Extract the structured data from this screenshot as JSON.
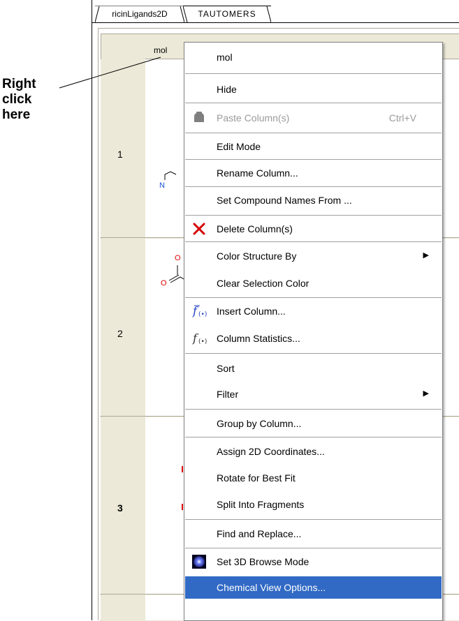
{
  "callout": {
    "line1": "Right",
    "line2": "click",
    "line3": "here"
  },
  "tabs": [
    {
      "label": "ricinLigands2D"
    },
    {
      "label": "TAUTOMERS"
    }
  ],
  "grid": {
    "column_header": "mol",
    "rows": [
      {
        "index": "1"
      },
      {
        "index": "2"
      },
      {
        "index": "3"
      }
    ],
    "atoms": {
      "n": "N",
      "o": "O"
    }
  },
  "context_menu": {
    "items": [
      {
        "label": "mol"
      },
      {
        "label": "Hide"
      },
      {
        "label": "Paste Column(s)",
        "shortcut": "Ctrl+V",
        "disabled": true
      },
      {
        "label": "Edit Mode"
      },
      {
        "label": "Rename Column..."
      },
      {
        "label": "Set Compound Names From ..."
      },
      {
        "label": "Delete Column(s)",
        "icon": "delete-x-icon"
      },
      {
        "label": "Color Structure By",
        "submenu": true
      },
      {
        "label": "Clear Selection Color"
      },
      {
        "label": "Insert Column...",
        "icon": "function-icon"
      },
      {
        "label": "Column Statistics...",
        "icon": "function-icon"
      },
      {
        "label": "Sort"
      },
      {
        "label": "Filter",
        "submenu": true
      },
      {
        "label": "Group by Column..."
      },
      {
        "label": "Assign 2D Coordinates..."
      },
      {
        "label": "Rotate for Best Fit"
      },
      {
        "label": "Split Into Fragments"
      },
      {
        "label": "Find and Replace..."
      },
      {
        "label": "Set 3D Browse Mode",
        "icon": "3d-sphere-icon"
      },
      {
        "label": "Chemical View Options...",
        "selected": true
      }
    ],
    "submenu_arrow": "▶",
    "selected_color": "#316ac5"
  }
}
